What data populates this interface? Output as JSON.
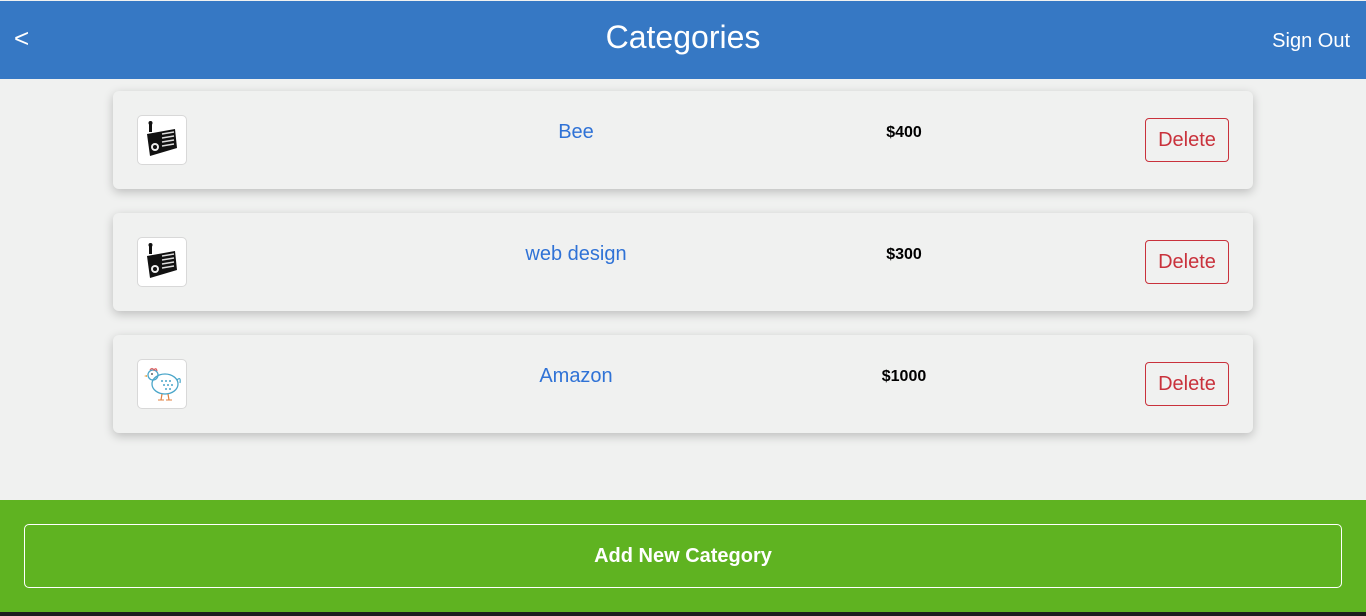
{
  "header": {
    "back_label": "<",
    "title": "Categories",
    "signout_label": "Sign Out"
  },
  "categories": [
    {
      "name": "Bee",
      "price": "$400",
      "delete_label": "Delete",
      "icon": "radio-icon"
    },
    {
      "name": "web design",
      "price": "$300",
      "delete_label": "Delete",
      "icon": "radio-icon"
    },
    {
      "name": "Amazon",
      "price": "$1000",
      "delete_label": "Delete",
      "icon": "chicken-icon"
    }
  ],
  "footer": {
    "add_label": "Add New Category"
  },
  "colors": {
    "header_bg": "#3678c4",
    "footer_bg": "#5fb321",
    "link": "#2f72d6",
    "danger": "#c9323c",
    "page_bg": "#f0f1f0"
  }
}
